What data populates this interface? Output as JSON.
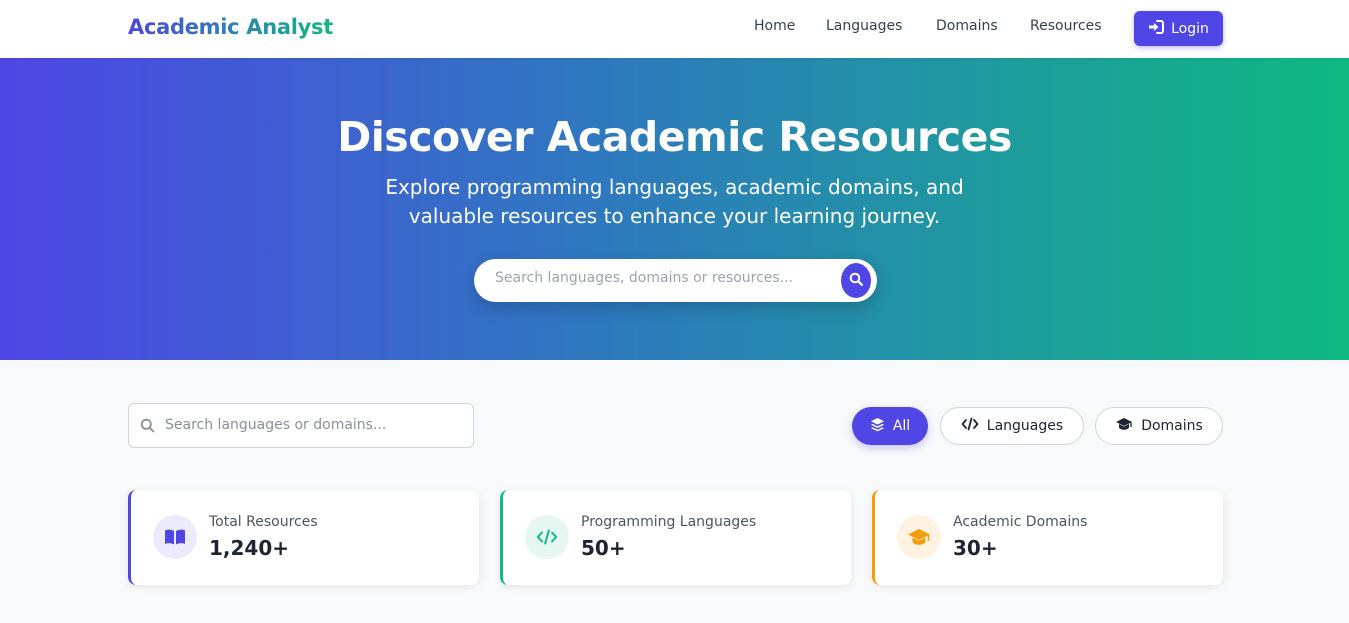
{
  "brand": {
    "name": "Academic Analyst"
  },
  "nav": {
    "links": [
      {
        "label": "Home"
      },
      {
        "label": "Languages"
      },
      {
        "label": "Domains"
      },
      {
        "label": "Resources"
      }
    ],
    "login_label": "Login"
  },
  "hero": {
    "title": "Discover Academic Resources",
    "subtitle_line1": "Explore programming languages, academic domains, and",
    "subtitle_line2": "valuable resources to enhance your learning journey.",
    "search_placeholder": "Search languages, domains or resources..."
  },
  "filters": {
    "search_placeholder": "Search languages or domains...",
    "pills": [
      {
        "label": "All",
        "icon": "layers-icon",
        "active": true
      },
      {
        "label": "Languages",
        "icon": "code-icon",
        "active": false
      },
      {
        "label": "Domains",
        "icon": "graduation-cap-icon",
        "active": false
      }
    ]
  },
  "stats": [
    {
      "label": "Total Resources",
      "value": "1,240+",
      "icon": "book-icon",
      "accent": "#4f46e5",
      "icon_bg": "#ecebfd"
    },
    {
      "label": "Programming Languages",
      "value": "50+",
      "icon": "code-icon",
      "accent": "#10b981",
      "icon_bg": "#e6f7f1"
    },
    {
      "label": "Academic Domains",
      "value": "30+",
      "icon": "graduation-cap-icon",
      "accent": "#f59e0b",
      "icon_bg": "#fef3e2"
    }
  ],
  "colors": {
    "primary": "#4f46e5",
    "secondary": "#10b981",
    "warning": "#f59e0b"
  }
}
